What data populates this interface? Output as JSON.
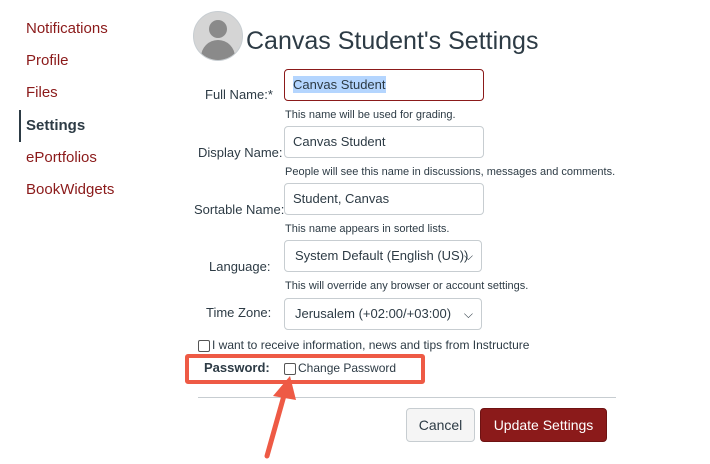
{
  "nav": {
    "items": [
      {
        "label": "Notifications"
      },
      {
        "label": "Profile"
      },
      {
        "label": "Files"
      },
      {
        "label": "Settings"
      },
      {
        "label": "ePortfolios"
      },
      {
        "label": "BookWidgets"
      }
    ],
    "active": "Settings"
  },
  "header": {
    "title": "Canvas Student's Settings"
  },
  "form": {
    "full_name": {
      "label": "Full Name:*",
      "value": "Canvas Student",
      "hint": "This name will be used for grading."
    },
    "display_name": {
      "label": "Display Name:",
      "value": "Canvas Student",
      "hint": "People will see this name in discussions, messages and comments."
    },
    "sortable_name": {
      "label": "Sortable Name:",
      "value": "Student, Canvas",
      "hint": "This name appears in sorted lists."
    },
    "language": {
      "label": "Language:",
      "value": "System Default (English (US))",
      "hint": "This will override any browser or account settings."
    },
    "time_zone": {
      "label": "Time Zone:",
      "value": "Jerusalem (+02:00/+03:00)"
    },
    "marketing_checkbox": {
      "label": "I want to receive information, news and tips from Instructure",
      "checked": false
    },
    "password": {
      "label": "Password:",
      "checkbox_label": "Change Password",
      "checked": false
    }
  },
  "buttons": {
    "cancel": "Cancel",
    "update": "Update Settings"
  },
  "colors": {
    "brand": "#8b1a1a",
    "annotation": "#ee5a45",
    "selection": "#b4d5fe"
  }
}
